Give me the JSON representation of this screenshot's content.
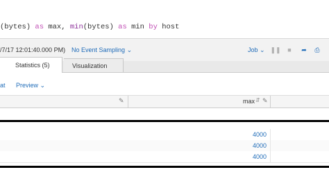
{
  "search": {
    "query_parts": [
      {
        "text": "(bytes) ",
        "kind": "plain"
      },
      {
        "text": "as",
        "kind": "kw"
      },
      {
        "text": " max, ",
        "kind": "plain"
      },
      {
        "text": "min",
        "kind": "fn"
      },
      {
        "text": "(bytes) ",
        "kind": "plain"
      },
      {
        "text": "as",
        "kind": "kw"
      },
      {
        "text": " min ",
        "kind": "plain"
      },
      {
        "text": "by",
        "kind": "kw"
      },
      {
        "text": " host",
        "kind": "plain"
      }
    ]
  },
  "job_bar": {
    "time_range": "/7/17 12:01:40.000 PM)",
    "sampling_label": "No Event Sampling",
    "job_label": "Job",
    "icons": [
      "pause-icon",
      "stop-icon",
      "share-icon",
      "print-icon"
    ]
  },
  "tabs": [
    {
      "label": "Statistics (5)",
      "active": true
    },
    {
      "label": "Visualization",
      "active": false
    }
  ],
  "options": {
    "format_label": "at",
    "preview_label": "Preview"
  },
  "table": {
    "column_max_label": "max",
    "rows": [
      {
        "max": "4000"
      },
      {
        "max": "4000"
      },
      {
        "max": "4000"
      }
    ]
  },
  "colors": {
    "link": "#1e6bb8",
    "keyword": "#c14fb5",
    "function": "#8c2f9a"
  }
}
